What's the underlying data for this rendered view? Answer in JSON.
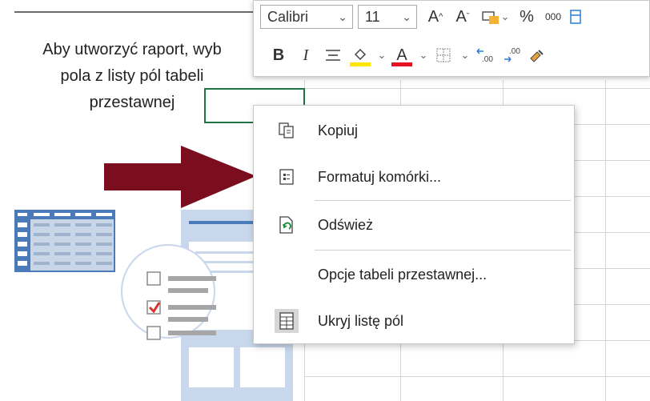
{
  "background_text": {
    "lines": [
      "Aby utworzyć raport, wyb",
      "pola z listy pól tabeli",
      "przestawnej"
    ]
  },
  "mini_toolbar": {
    "font_name": "Calibri",
    "font_size": "11",
    "bold": "B",
    "italic": "I",
    "increase_font": "A",
    "decrease_font": "A",
    "percent": "%",
    "thousands": "000",
    "font_color_accent": "#e81123",
    "highlight_color_accent": "#ffe500"
  },
  "context_menu": {
    "items": [
      {
        "label": "Kopiuj",
        "icon": "copy-icon"
      },
      {
        "label": "Formatuj komórki...",
        "icon": "format-cells-icon"
      },
      {
        "label": "Odśwież",
        "icon": "refresh-icon"
      },
      {
        "label": "Opcje tabeli przestawnej...",
        "icon": ""
      },
      {
        "label": "Ukryj listę pól",
        "icon": "field-list-icon"
      }
    ]
  },
  "colors": {
    "arrow": "#7a0d1e",
    "selection": "#217346",
    "illustration_blue": "#4a7ab8",
    "check_red": "#d9342b"
  }
}
